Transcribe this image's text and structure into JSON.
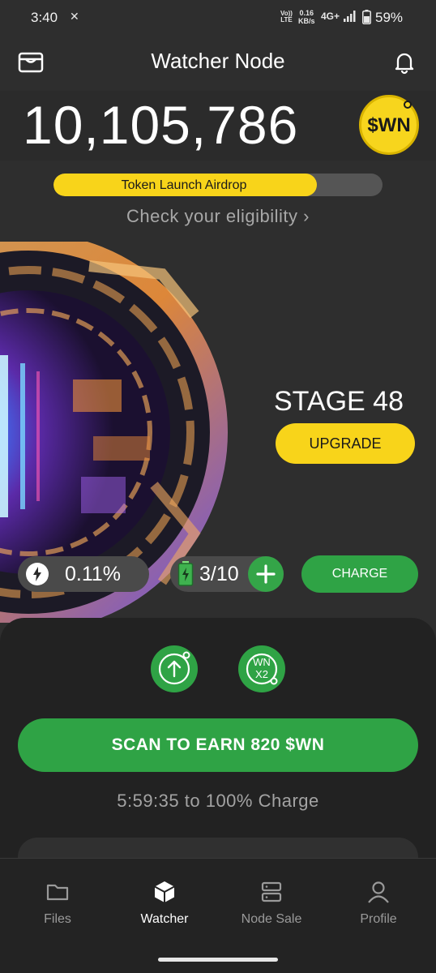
{
  "status_bar": {
    "time": "3:40",
    "volte_top": "Vo))",
    "volte_bottom": "LTE",
    "speed_value": "0.16",
    "speed_unit": "KB/s",
    "network": "4G+",
    "battery_percent": "59%"
  },
  "header": {
    "title": "Watcher Node",
    "left_icon": "wallet-icon",
    "right_icon": "bell-icon"
  },
  "balance": {
    "amount": "10,105,786",
    "token_badge": "$WN"
  },
  "airdrop": {
    "label": "Token Launch Airdrop",
    "progress": 0.8,
    "eligibility_link": "Check your eligibility ›"
  },
  "node": {
    "stage": "STAGE 48",
    "upgrade_label": "UPGRADE",
    "charge_rate": "0.11%",
    "battery_count": "3/10",
    "charge_label": "CHARGE"
  },
  "actions": {
    "boost_icon": "arrow-up-icon",
    "multiplier_top": "WN",
    "multiplier_bottom": "X2",
    "scan_label": "SCAN TO EARN 820 $WN",
    "timer_text": "5:59:35 to 100% Charge"
  },
  "nav": {
    "items": [
      {
        "label": "Files",
        "icon": "folder-icon"
      },
      {
        "label": "Watcher",
        "icon": "cube-icon"
      },
      {
        "label": "Node Sale",
        "icon": "server-icon"
      },
      {
        "label": "Profile",
        "icon": "user-icon"
      }
    ],
    "active_index": 1
  },
  "colors": {
    "background": "#2e2e2e",
    "accent_yellow": "#f8d41a",
    "accent_green": "#2fa345",
    "muted_text": "#a8a8a8"
  }
}
